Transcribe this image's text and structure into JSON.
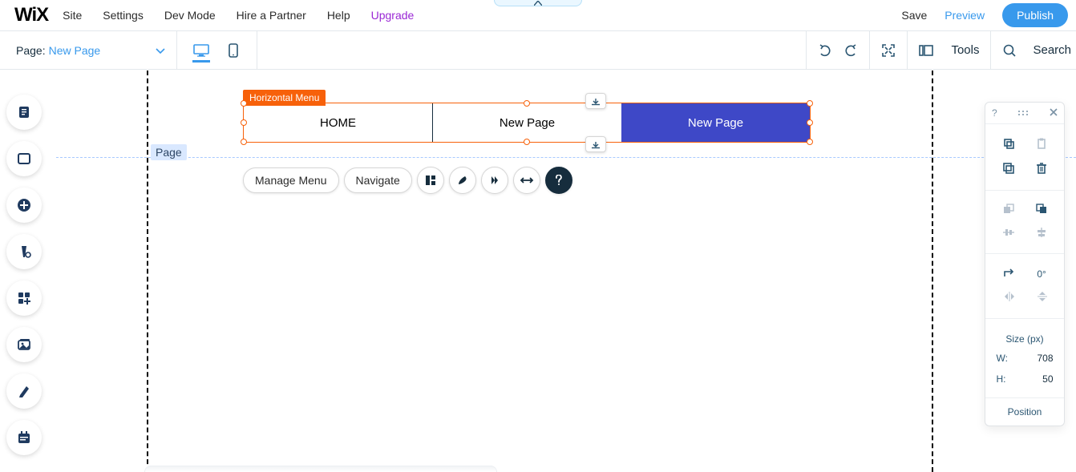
{
  "logo": "WiX",
  "top_tab_arrow": "▲",
  "menu": {
    "site": "Site",
    "settings": "Settings",
    "devmode": "Dev Mode",
    "hire": "Hire a Partner",
    "help": "Help",
    "upgrade": "Upgrade"
  },
  "top_right": {
    "save": "Save",
    "preview": "Preview",
    "publish": "Publish"
  },
  "subbar": {
    "page_label": "Page:",
    "page_value": "New Page",
    "tools": "Tools",
    "search": "Search"
  },
  "canvas": {
    "page_tag": "Page",
    "selection_label": "Horizontal Menu",
    "menu_items": [
      "HOME",
      "New Page",
      "New Page"
    ],
    "action_pills": [
      "Manage Menu",
      "Navigate"
    ]
  },
  "inspector": {
    "rotation": "0°",
    "size_title": "Size (px)",
    "w_label": "W:",
    "w_value": "708",
    "h_label": "H:",
    "h_value": "50",
    "position_title": "Position"
  }
}
